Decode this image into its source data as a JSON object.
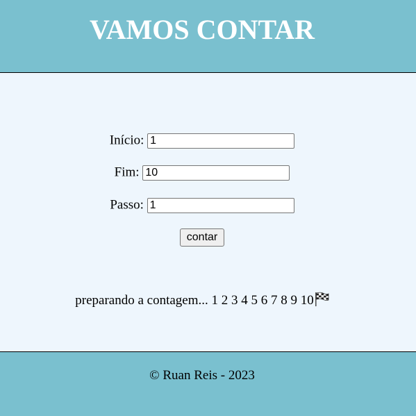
{
  "header": {
    "title": "VAMOS CONTAR"
  },
  "form": {
    "inicio_label": "Início:",
    "inicio_value": "1",
    "fim_label": "Fim:",
    "fim_value": "10",
    "passo_label": "Passo:",
    "passo_value": "1",
    "button_label": "contar"
  },
  "result": {
    "prefix": "preparando a contagem...",
    "numbers": "1 2 3 4 5 6 7 8 9 10",
    "end_icon": "checkered-flag-icon"
  },
  "footer": {
    "text": "© Ruan Reis - 2023"
  },
  "colors": {
    "header_bg": "#7ac0cf",
    "main_bg": "#eef6fd",
    "footer_bg": "#7ac0cf",
    "title_color": "#ffffff"
  }
}
